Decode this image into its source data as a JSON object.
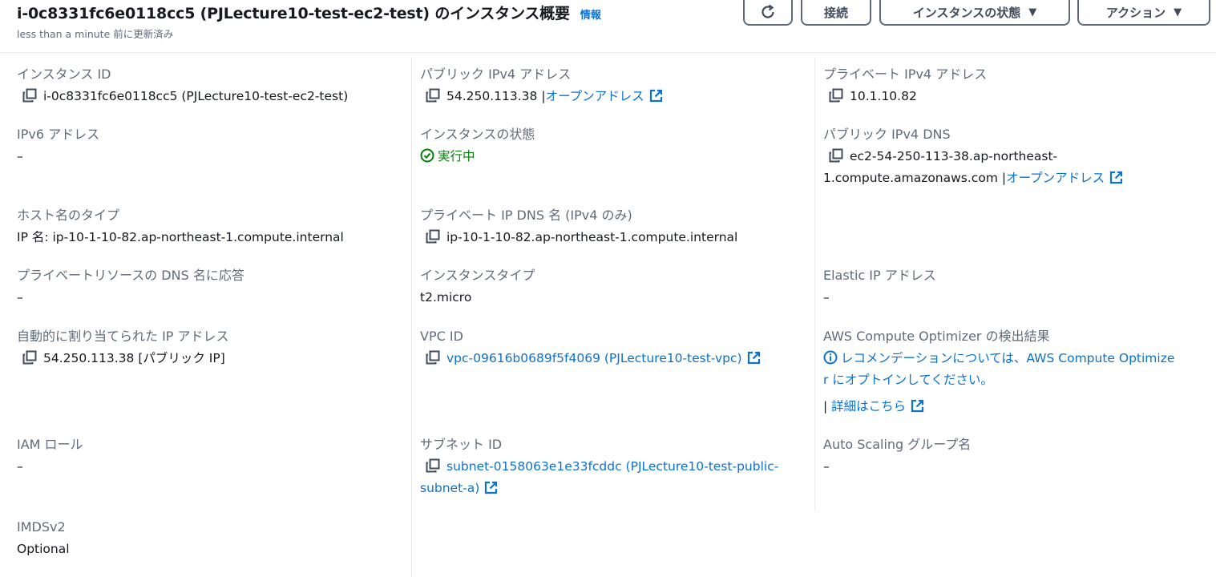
{
  "header": {
    "title": "i-0c8331fc6e0118cc5 (PJLecture10-test-ec2-test) のインスタンス概要",
    "info_label": "情報",
    "subtitle": "less than a minute 前に更新済み",
    "connect_label": "接続",
    "instance_state_label": "インスタンスの状態",
    "actions_label": "アクション"
  },
  "fields": {
    "instance_id": {
      "label": "インスタンス ID",
      "value": "i-0c8331fc6e0118cc5 (PJLecture10-test-ec2-test)"
    },
    "public_ipv4": {
      "label": "パブリック IPv4 アドレス",
      "value": "54.250.113.38",
      "link": "オープンアドレス"
    },
    "private_ipv4": {
      "label": "プライベート IPv4 アドレス",
      "value": "10.1.10.82"
    },
    "ipv6": {
      "label": "IPv6 アドレス",
      "value": "–"
    },
    "instance_state": {
      "label": "インスタンスの状態",
      "value": "実行中"
    },
    "public_dns": {
      "label": "パブリック IPv4 DNS",
      "value_line1": "ec2-54-250-113-38.ap-northeast-",
      "value_line2": "1.compute.amazonaws.com",
      "link": "オープンアドレス"
    },
    "hostname_type": {
      "label": "ホスト名のタイプ",
      "value": "IP 名: ip-10-1-10-82.ap-northeast-1.compute.internal"
    },
    "private_ip_dns": {
      "label": "プライベート IP DNS 名 (IPv4 のみ)",
      "value": "ip-10-1-10-82.ap-northeast-1.compute.internal"
    },
    "private_resource_dns": {
      "label": "プライベートリソースの DNS 名に応答",
      "value": "–"
    },
    "instance_type": {
      "label": "インスタンスタイプ",
      "value": "t2.micro"
    },
    "elastic_ip": {
      "label": "Elastic IP アドレス",
      "value": "–"
    },
    "auto_ip": {
      "label": "自動的に割り当てられた IP アドレス",
      "value": "54.250.113.38 [パブリック IP]"
    },
    "vpc_id": {
      "label": "VPC ID",
      "value": "vpc-09616b0689f5f4069 (PJLecture10-test-vpc)"
    },
    "compute_optimizer": {
      "label": "AWS Compute Optimizer の検出結果",
      "value_line1": "レコメンデーションについては、AWS Compute Optimize",
      "value_line2": "r にオプトインしてください。",
      "link": "詳細はこちら"
    },
    "iam_role": {
      "label": "IAM ロール",
      "value": "–"
    },
    "subnet_id": {
      "label": "サブネット ID",
      "value_line1": "subnet-0158063e1e33fcddc (PJLecture10-test-public-",
      "value_line2": "subnet-a)"
    },
    "auto_scaling": {
      "label": "Auto Scaling グループ名",
      "value": "–"
    },
    "imdsv2": {
      "label": "IMDSv2",
      "value": "Optional"
    }
  },
  "colors": {
    "link": "#0972d3",
    "running": "#037f0c",
    "label": "#5f6b7a",
    "divider": "#e9ebed"
  }
}
